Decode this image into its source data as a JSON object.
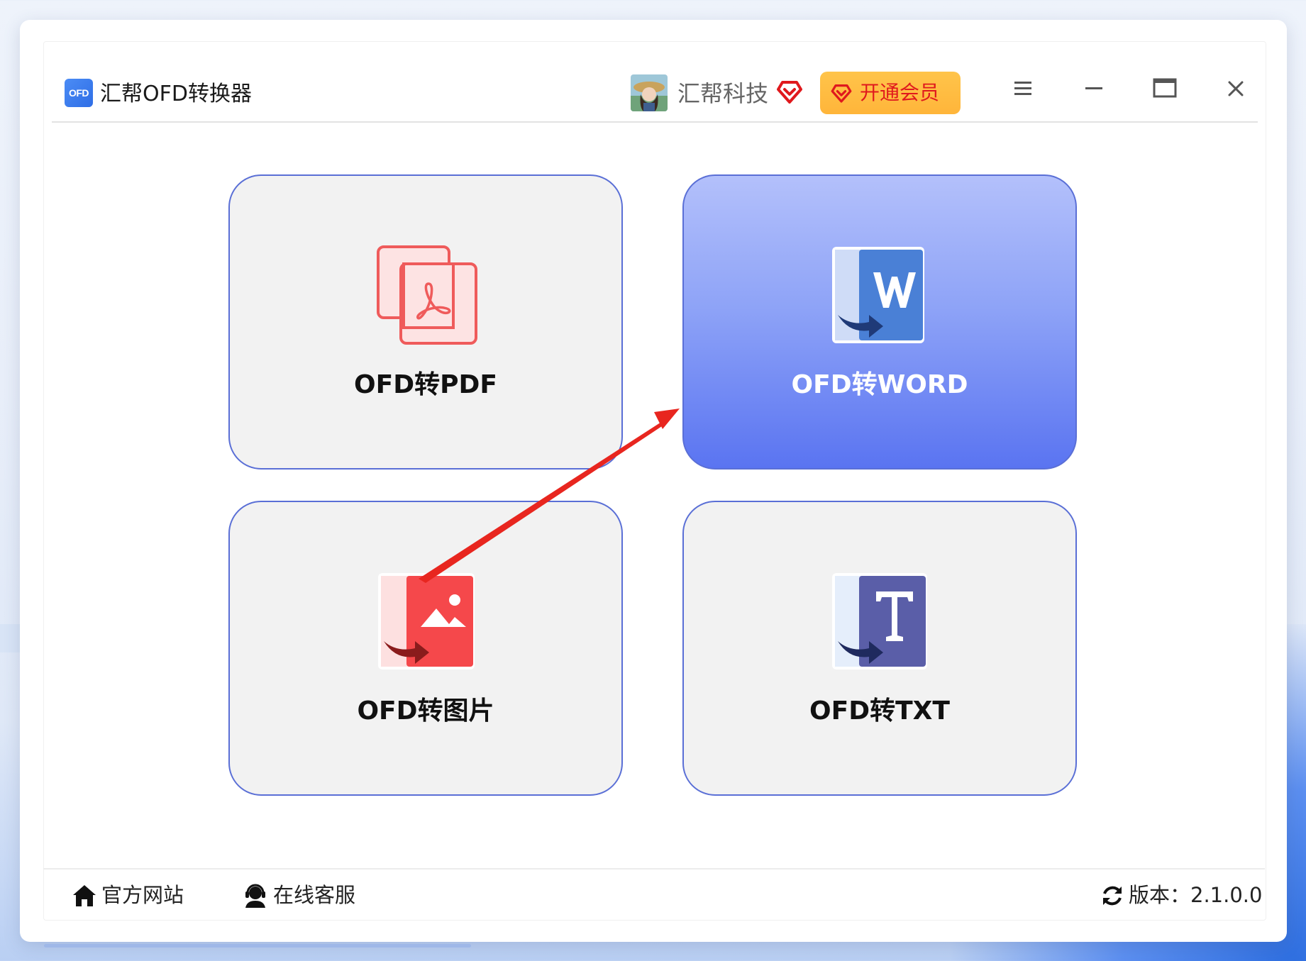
{
  "app": {
    "title": "汇帮OFD转换器",
    "logo_text": "OFD"
  },
  "user": {
    "name": "汇帮科技"
  },
  "titlebar": {
    "vip_button_label": "开通会员",
    "menu_icon": "hamburger-menu-icon",
    "minimize_icon": "minimize-icon",
    "maximize_icon": "maximize-icon",
    "close_icon": "close-icon"
  },
  "cards": [
    {
      "label": "OFD转PDF",
      "icon": "pdf-document-icon",
      "active": false
    },
    {
      "label": "OFD转WORD",
      "icon": "word-document-icon",
      "active": true
    },
    {
      "label": "OFD转图片",
      "icon": "image-document-icon",
      "active": false
    },
    {
      "label": "OFD转TXT",
      "icon": "text-document-icon",
      "active": false
    }
  ],
  "footer": {
    "website_label": "官方网站",
    "support_label": "在线客服",
    "version_label": "版本：2.1.0.0"
  },
  "colors": {
    "accent": "#5a74f1",
    "card_border": "#5a6fd6",
    "vip_button": "#ffb53a",
    "vip_text": "#e0191d",
    "annotation_arrow": "#e8261f"
  }
}
